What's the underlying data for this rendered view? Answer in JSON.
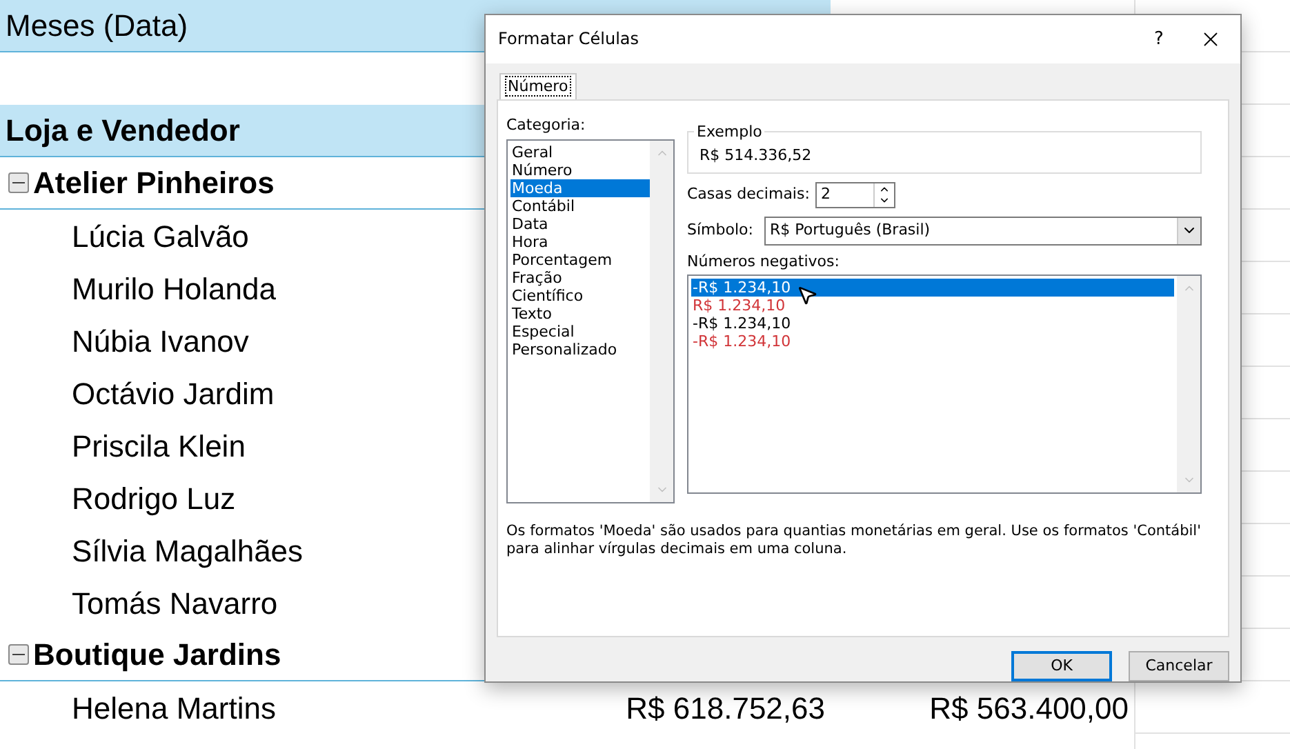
{
  "sheet": {
    "rows": [
      {
        "kind": "header",
        "text": "Meses (Data)",
        "bold": false
      },
      {
        "kind": "blank"
      },
      {
        "kind": "header",
        "text": "Loja e Vendedor",
        "bold": true
      },
      {
        "kind": "group",
        "text": "Atelier Pinheiros",
        "expanded": true
      },
      {
        "kind": "item",
        "text": "Lúcia Galvão"
      },
      {
        "kind": "item",
        "text": "Murilo Holanda"
      },
      {
        "kind": "item",
        "text": "Núbia Ivanov"
      },
      {
        "kind": "item",
        "text": "Octávio Jardim"
      },
      {
        "kind": "item",
        "text": "Priscila Klein"
      },
      {
        "kind": "item",
        "text": "Rodrigo Luz"
      },
      {
        "kind": "item",
        "text": "Sílvia Magalhães"
      },
      {
        "kind": "item",
        "text": "Tomás Navarro"
      },
      {
        "kind": "group",
        "text": "Boutique Jardins",
        "expanded": true
      },
      {
        "kind": "item",
        "text": "Helena Martins",
        "values": [
          "R$ 618.752,63",
          "R$ 563.400,00"
        ]
      },
      {
        "kind": "blank"
      }
    ]
  },
  "dialog": {
    "title": "Formatar Células",
    "help": "?",
    "tabs": [
      {
        "label": "Número",
        "selected": true
      }
    ],
    "category_label": "Categoria:",
    "categories": [
      {
        "label": "Geral",
        "selected": false
      },
      {
        "label": "Número",
        "selected": false
      },
      {
        "label": "Moeda",
        "selected": true
      },
      {
        "label": "Contábil",
        "selected": false
      },
      {
        "label": "Data",
        "selected": false
      },
      {
        "label": "Hora",
        "selected": false
      },
      {
        "label": "Porcentagem",
        "selected": false
      },
      {
        "label": "Fração",
        "selected": false
      },
      {
        "label": "Científico",
        "selected": false
      },
      {
        "label": "Texto",
        "selected": false
      },
      {
        "label": "Especial",
        "selected": false
      },
      {
        "label": "Personalizado",
        "selected": false
      }
    ],
    "sample": {
      "label": "Exemplo",
      "value": "R$ 514.336,52"
    },
    "decimals": {
      "label": "Casas decimais:",
      "value": "2"
    },
    "symbol": {
      "label": "Símbolo:",
      "value": "R$ Português (Brasil)"
    },
    "negatives_label": "Números negativos:",
    "negatives": [
      {
        "label": "-R$ 1.234,10",
        "selected": true
      },
      {
        "label": "R$ 1.234,10",
        "color": "#d13438",
        "selected": false
      },
      {
        "label": "-R$ 1.234,10",
        "color": "#000000",
        "selected": false
      },
      {
        "label": "-R$ 1.234,10",
        "color": "#d13438",
        "selected": false
      }
    ],
    "description": "Os formatos 'Moeda' são usados para quantias monetárias em geral. Use os formatos 'Contábil' para alinhar vírgulas decimais em uma coluna.",
    "buttons": [
      {
        "label": "OK",
        "default": true
      },
      {
        "label": "Cancelar",
        "default": false
      }
    ]
  }
}
